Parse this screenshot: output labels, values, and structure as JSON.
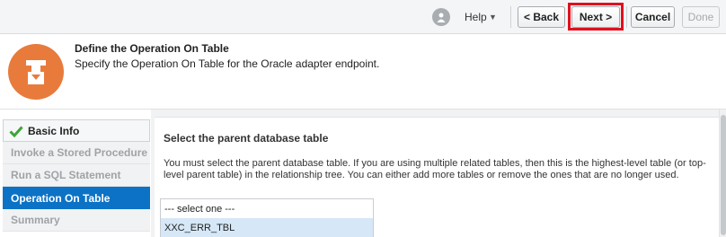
{
  "toolbar": {
    "help_label": "Help",
    "back_label": "< Back",
    "next_label": "Next >",
    "cancel_label": "Cancel",
    "done_label": "Done",
    "highlight_color": "#e0101e"
  },
  "header": {
    "title": "Define the Operation On Table",
    "subtitle": "Specify the Operation On Table for the Oracle adapter endpoint.",
    "icon": "operation-on-table-icon",
    "icon_color": "#e87b3c"
  },
  "sidebar": {
    "items": [
      {
        "label": "Basic Info",
        "state": "completed"
      },
      {
        "label": "Invoke a Stored Procedure",
        "state": "disabled"
      },
      {
        "label": "Run a SQL Statement",
        "state": "disabled"
      },
      {
        "label": "Operation On Table",
        "state": "active"
      },
      {
        "label": "Summary",
        "state": "disabled"
      }
    ],
    "active_color": "#0c72c5"
  },
  "main": {
    "section_title": "Select the parent database table",
    "description": "You must select the parent database table. If you are using multiple related tables, then this is the highest-level table (or top-level parent table) in the relationship tree. You can either add more tables or remove the ones that are no longer used.",
    "table_list": {
      "options": [
        "--- select one ---",
        "XXC_ERR_TBL"
      ],
      "selected_index": 1
    }
  }
}
